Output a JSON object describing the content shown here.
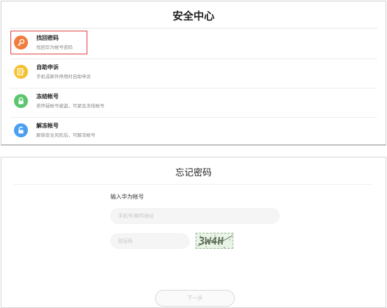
{
  "security_center": {
    "title": "安全中心",
    "items": [
      {
        "title": "找回密码",
        "subtitle": "找回华为帐号密码",
        "icon": "key-icon",
        "color": "#f07d3c"
      },
      {
        "title": "自助申诉",
        "subtitle": "手机或邮件停用时自助申诉",
        "icon": "edit-document-icon",
        "color": "#f5c131"
      },
      {
        "title": "冻结帐号",
        "subtitle": "若怀疑帐号被盗，可紧急冻结帐号",
        "icon": "lock-icon",
        "color": "#5cc66d"
      },
      {
        "title": "解冻帐号",
        "subtitle": "解除安全风险后，可解冻帐号",
        "icon": "unlock-icon",
        "color": "#4a9ff0"
      }
    ]
  },
  "forgot_password": {
    "title": "忘记密码",
    "account_label": "输入华为帐号",
    "account_placeholder": "手机号/邮件地址",
    "code_placeholder": "验证码",
    "captcha_text": "3W4H",
    "next_label": "下一步"
  }
}
